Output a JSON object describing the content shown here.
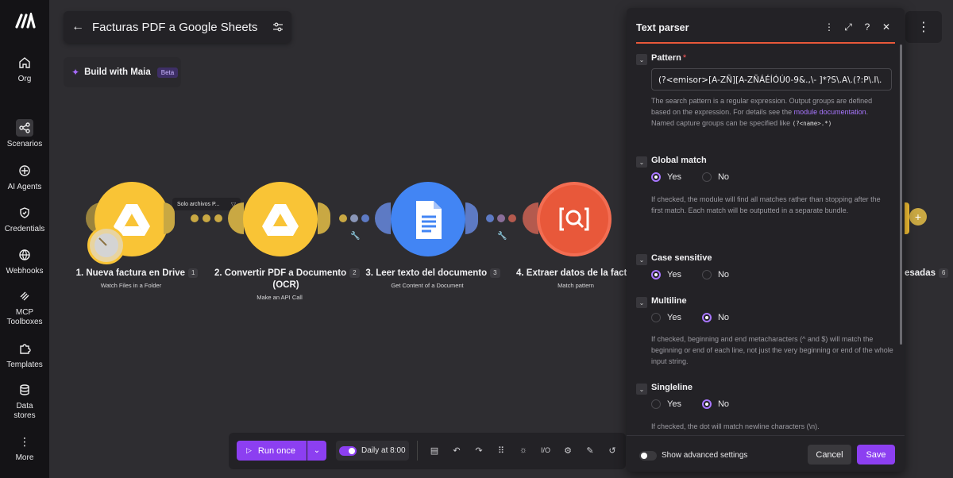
{
  "nav": {
    "items": [
      {
        "label": "Org",
        "icon": "home-icon"
      },
      {
        "label": "Scenarios",
        "icon": "share-icon"
      },
      {
        "label": "AI Agents",
        "icon": "sparkle-icon"
      },
      {
        "label": "Credentials",
        "icon": "shield-icon"
      },
      {
        "label": "Webhooks",
        "icon": "globe-icon"
      },
      {
        "label": "MCP Toolboxes",
        "icon": "mcp-icon"
      },
      {
        "label": "Templates",
        "icon": "puzzle-icon"
      },
      {
        "label": "Data stores",
        "icon": "database-icon"
      },
      {
        "label": "More",
        "icon": "more-vertical-icon"
      }
    ]
  },
  "header": {
    "title": "Facturas PDF a Google Sheets",
    "maia_label": "Build with Maia",
    "maia_badge": "Beta"
  },
  "canvas": {
    "filter_label": "Solo archivos P...",
    "modules": [
      {
        "title": "1. Nueva factura en Drive",
        "num": "1",
        "sub": "Watch Files in a Folder"
      },
      {
        "title": "2. Convertir PDF a Documento",
        "title2": "(OCR)",
        "num": "2",
        "sub": "Make an API Call"
      },
      {
        "title": "3. Leer texto del documento",
        "num": "3",
        "sub": "Get Content of a Document"
      },
      {
        "title": "4. Extraer datos de la factu",
        "num": "",
        "sub": "Match pattern"
      },
      {
        "title": "esadas",
        "num": "6",
        "sub": ""
      }
    ],
    "colors": {
      "drive": "#f9c436",
      "docs": "#4285f4",
      "parser": "#e8583a",
      "accent": "#8c3ff1"
    }
  },
  "toolbar": {
    "run_label": "Run once",
    "schedule_label": "Daily at 8:00"
  },
  "panel": {
    "title": "Text parser",
    "pattern_label": "Pattern",
    "required_mark": "*",
    "pattern_value": "(?<emisor>[A-ZÑ][A-ZÑÁÉÍÓÚ0-9&.,\\- ]*?S\\.A\\.(?:P\\.I\\.",
    "pattern_help_1": "The search pattern is a regular expression. Output groups are defined based on the expression. For details see the ",
    "pattern_help_link": "module documentation",
    "pattern_help_2": ".",
    "pattern_help_3": "Named capture groups can be specified like ",
    "pattern_help_code": "(?<name>.*)",
    "global_label": "Global match",
    "global_help": "If checked, the module will find all matches rather than stopping after the first match. Each match will be outputted in a separate bundle.",
    "case_label": "Case sensitive",
    "multiline_label": "Multiline",
    "multiline_help": "If checked, beginning and end metacharacters (^ and $) will match the beginning or end of each line, not just the very beginning or end of the whole input string.",
    "singleline_label": "Singleline",
    "singleline_help": "If checked, the dot will match newline characters (\\n).",
    "yes": "Yes",
    "no": "No",
    "advanced_label": "Show advanced settings",
    "cancel_label": "Cancel",
    "save_label": "Save"
  }
}
